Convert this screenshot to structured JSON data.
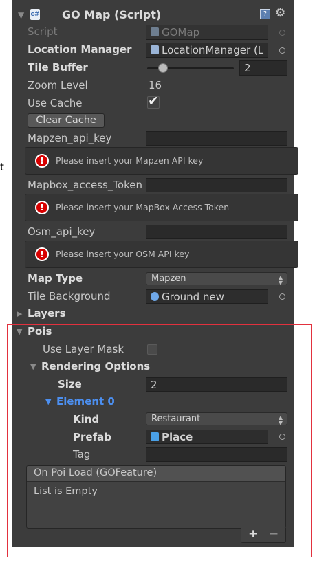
{
  "side_label": "t",
  "component": {
    "title": "GO Map (Script)",
    "foldout_icon": "triangle-down-icon",
    "script_icon": "csharp-script-icon",
    "help_icon": "help-book-icon",
    "settings_icon": "gear-icon"
  },
  "script": {
    "label": "Script",
    "value": "GOMap"
  },
  "location_manager": {
    "label": "Location Manager",
    "value": "LocationManager (L"
  },
  "tile_buffer": {
    "label": "Tile Buffer",
    "value": "2",
    "slider_fraction": 0.18
  },
  "zoom_level": {
    "label": "Zoom Level",
    "value": "16"
  },
  "use_cache": {
    "label": "Use Cache",
    "checked": true
  },
  "clear_cache": {
    "label": "Clear Cache"
  },
  "mapzen": {
    "label": "Mapzen_api_key",
    "value": "",
    "help": "Please insert your Mapzen API key"
  },
  "mapbox": {
    "label": "Mapbox_access_Token",
    "value": "",
    "help": "Please insert your MapBox Access Token"
  },
  "osm": {
    "label": "Osm_api_key",
    "value": "",
    "help": "Please insert your OSM API key"
  },
  "map_type": {
    "label": "Map Type",
    "value": "Mapzen"
  },
  "tile_background": {
    "label": "Tile Background",
    "value": "Ground new"
  },
  "layers": {
    "label": "Layers"
  },
  "pois": {
    "label": "Pois",
    "use_layer_mask": {
      "label": "Use Layer Mask",
      "checked": false
    },
    "rendering_options": {
      "label": "Rendering Options",
      "size": {
        "label": "Size",
        "value": "2"
      },
      "element0": {
        "label": "Element 0",
        "kind": {
          "label": "Kind",
          "value": "Restaurant"
        },
        "prefab": {
          "label": "Prefab",
          "value": "Place"
        },
        "tag": {
          "label": "Tag",
          "value": ""
        }
      }
    },
    "event": {
      "header": "On Poi Load (GOFeature)",
      "empty_text": "List is Empty",
      "add": "+",
      "remove": "−"
    }
  },
  "colors": {
    "panel": "#3c3c3c",
    "field": "#2a2a2a",
    "selected_element": "#4c8ff0",
    "selection_outline": "#e2313e",
    "error": "#d80000"
  }
}
